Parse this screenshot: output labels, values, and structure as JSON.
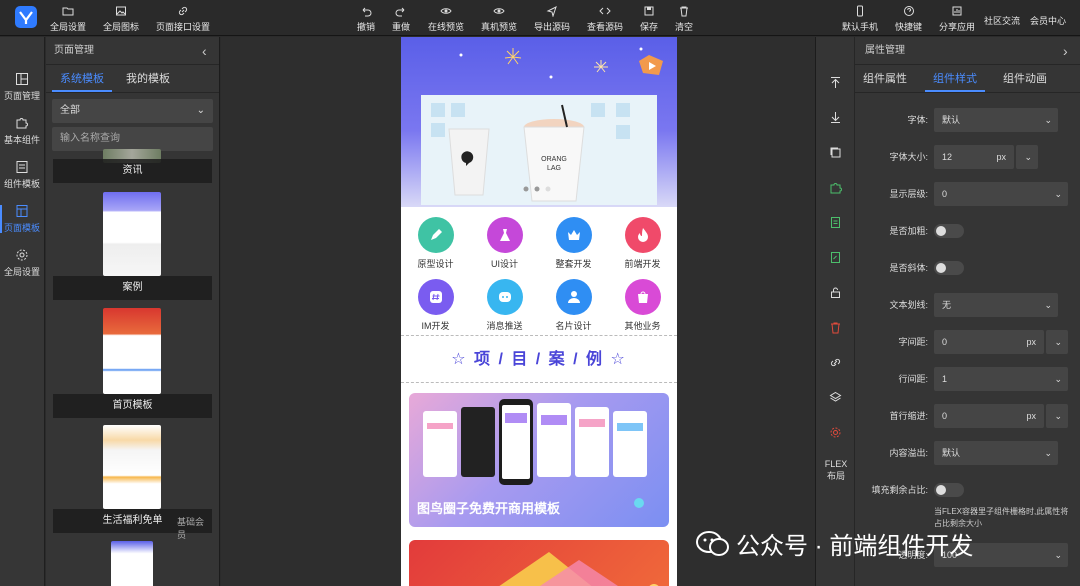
{
  "toolbar": {
    "left": [
      {
        "label": "全局设置",
        "icon": "folder-icon"
      },
      {
        "label": "全局图标",
        "icon": "image-icon"
      },
      {
        "label": "页面接口设置",
        "icon": "link-icon"
      }
    ],
    "center": [
      {
        "label": "撤销",
        "icon": "undo-icon"
      },
      {
        "label": "重做",
        "icon": "redo-icon"
      },
      {
        "label": "在线预览",
        "icon": "eye-icon"
      },
      {
        "label": "真机预览",
        "icon": "eye-icon"
      },
      {
        "label": "导出源码",
        "icon": "send-icon"
      },
      {
        "label": "查看源码",
        "icon": "code-icon"
      },
      {
        "label": "保存",
        "icon": "save-icon"
      },
      {
        "label": "清空",
        "icon": "trash-icon"
      }
    ],
    "right": [
      {
        "label": "默认手机",
        "icon": "phone-icon"
      },
      {
        "label": "快捷键",
        "icon": "help-icon"
      },
      {
        "label": "分享应用",
        "icon": "share-icon"
      },
      {
        "label": "社区交流",
        "icon": ""
      },
      {
        "label": "会员中心",
        "icon": ""
      }
    ]
  },
  "sidebar": {
    "items": [
      {
        "label": "页面管理",
        "icon": "layout-icon",
        "active": false
      },
      {
        "label": "基本组件",
        "icon": "puzzle-icon",
        "active": false
      },
      {
        "label": "组件模板",
        "icon": "template-icon",
        "active": false
      },
      {
        "label": "页面模板",
        "icon": "page-template-icon",
        "active": true
      },
      {
        "label": "全局设置",
        "icon": "gear-icon",
        "active": false
      }
    ]
  },
  "left_panel": {
    "title": "页面管理",
    "tabs": [
      {
        "label": "系统模板",
        "active": true
      },
      {
        "label": "我的模板",
        "active": false
      }
    ],
    "filter": "全部",
    "search_placeholder": "输入名称查询",
    "templates": [
      {
        "caption": "资讯"
      },
      {
        "caption": "案例"
      },
      {
        "caption": "首页模板"
      },
      {
        "caption": "生活福利免单"
      }
    ],
    "overlay_label": "基础会员"
  },
  "preview": {
    "icons": [
      {
        "label": "原型设计",
        "color": "#3fc3a4"
      },
      {
        "label": "UI设计",
        "color": "#c548d9"
      },
      {
        "label": "整套开发",
        "color": "#2f8ef3"
      },
      {
        "label": "前端开发",
        "color": "#f04a6a"
      },
      {
        "label": "IM开发",
        "color": "#7a5cf0"
      },
      {
        "label": "消息推送",
        "color": "#38b6f0"
      },
      {
        "label": "名片设计",
        "color": "#2f8ef3"
      },
      {
        "label": "其他业务",
        "color": "#d94ad6"
      }
    ],
    "section_title": "☆ 项 / 目 / 案 / 例 ☆",
    "case_title": "图鸟圈子免费开商用模板",
    "cup_text": "ORANG\nLAG"
  },
  "right_panel": {
    "title": "属性管理",
    "tabs": [
      {
        "label": "组件属性",
        "active": false
      },
      {
        "label": "组件样式",
        "active": true
      },
      {
        "label": "组件动画",
        "active": false
      }
    ],
    "flex_label": "FLEX布局",
    "props": [
      {
        "label": "字体:",
        "type": "select",
        "value": "默认"
      },
      {
        "label": "字体大小:",
        "type": "unit",
        "value": "12",
        "unit": "px"
      },
      {
        "label": "显示层级:",
        "type": "select",
        "value": "0"
      },
      {
        "label": "是否加粗:",
        "type": "toggle",
        "value": false
      },
      {
        "label": "是否斜体:",
        "type": "toggle",
        "value": false
      },
      {
        "label": "文本划线:",
        "type": "select",
        "value": "无"
      },
      {
        "label": "字间距:",
        "type": "unit",
        "value": "0",
        "unit": "px"
      },
      {
        "label": "行间距:",
        "type": "select",
        "value": "1"
      },
      {
        "label": "首行缩进:",
        "type": "unit",
        "value": "0",
        "unit": "px"
      },
      {
        "label": "内容溢出:",
        "type": "select",
        "value": "默认"
      },
      {
        "label": "填充剩余占比:",
        "type": "toggle",
        "value": false
      }
    ],
    "note": "当FLEX容器里子组件栅格时,此属性将占比剩余大小",
    "opacity_label": "透明度:",
    "opacity_value": "100"
  },
  "watermark": {
    "text": "公众号 · 前端组件开发"
  },
  "colors": {
    "accent": "#4a8cff",
    "active_blue": "#4a8cff",
    "case_title": "#4a45d8"
  }
}
